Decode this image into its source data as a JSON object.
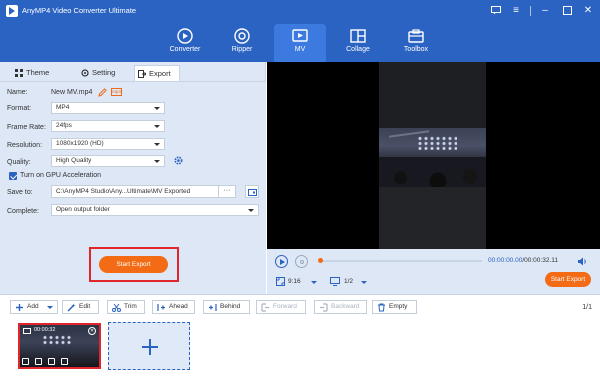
{
  "app": {
    "title": "AnyMP4 Video Converter Ultimate"
  },
  "nav": {
    "tabs": [
      {
        "label": "Converter",
        "icon": "converter-icon"
      },
      {
        "label": "Ripper",
        "icon": "ripper-icon"
      },
      {
        "label": "MV",
        "icon": "mv-icon",
        "active": true
      },
      {
        "label": "Collage",
        "icon": "collage-icon"
      },
      {
        "label": "Toolbox",
        "icon": "toolbox-icon"
      }
    ]
  },
  "subtabs": {
    "theme": "Theme",
    "setting": "Setting",
    "export": "Export"
  },
  "form": {
    "name_label": "Name:",
    "name_value": "New MV.mp4",
    "format_label": "Format:",
    "format_value": "MP4",
    "framerate_label": "Frame Rate:",
    "framerate_value": "24fps",
    "resolution_label": "Resolution:",
    "resolution_value": "1080x1920 (HD)",
    "quality_label": "Quality:",
    "quality_value": "High Quality",
    "gpu_label": "Turn on GPU Acceleration",
    "gpu_checked": true,
    "saveto_label": "Save to:",
    "saveto_value": "C:\\AnyMP4 Studio\\Any...Ultimate\\MV Exported",
    "more_label": "···",
    "complete_label": "Complete:",
    "complete_value": "Open output folder"
  },
  "start_export_label": "Start Export",
  "player": {
    "time_current": "00:00:00.00",
    "time_total": "/00:00:32.11",
    "ratio": "9:16",
    "zoom": "1/2",
    "export_label": "Start Export"
  },
  "toolbar": {
    "add": "Add",
    "edit": "Edit",
    "trim": "Trim",
    "ahead": "Ahead",
    "behind": "Behind",
    "forward": "Forward",
    "backward": "Backward",
    "empty": "Empty",
    "page": "1/1"
  },
  "timeline": {
    "clip_time": "00:00:32"
  },
  "colors": {
    "brand_blue": "#2b63c3",
    "accent_orange": "#f36b14",
    "highlight_red": "#e0262b",
    "panel_bg": "#dde7f5"
  }
}
